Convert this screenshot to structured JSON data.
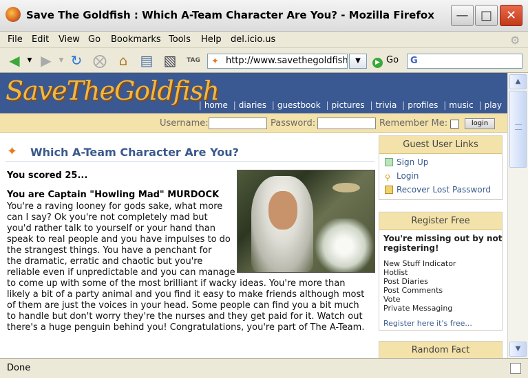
{
  "window": {
    "title": "Save The Goldfish : Which A-Team Character Are You? - Mozilla Firefox"
  },
  "menu": [
    "File",
    "Edit",
    "View",
    "Go",
    "Bookmarks",
    "Tools",
    "Help",
    "del.icio.us"
  ],
  "toolbar": {
    "url": "http://www.savethegoldfish.c",
    "go_label": "Go",
    "search_value": "G",
    "icons": [
      "back-icon",
      "forward-icon",
      "reload-icon",
      "stop-icon",
      "home-icon",
      "print-icon",
      "screenshot-icon",
      "tag-icon"
    ]
  },
  "site": {
    "logo": "SaveTheGoldfish",
    "nav": [
      "home",
      "diaries",
      "guestbook",
      "pictures",
      "trivia",
      "profiles",
      "music",
      "play"
    ],
    "login": {
      "username_label": "Username:",
      "password_label": "Password:",
      "remember_label": "Remember Me:",
      "login_button": "login"
    }
  },
  "article": {
    "heading": "Which A-Team Character Are You?",
    "scored": "You scored 25...",
    "result": "You are Captain \"Howling Mad\" MURDOCK",
    "lines": [
      "You're a raving looney for gods sake, what more",
      "can I say? Ok you're not completely mad but",
      "you'd rather talk to yourself or your hand than",
      "speak to real people and you have impulses to do",
      "the strangest things. You have a penchant for",
      "the dramatic, erratic and chaotic but you're",
      "reliable even if unpredictable and you can manage",
      "to come up with some of the most brilliant if wacky ideas. You're more than",
      "likely a bit of a party animal and you find it easy to make friends although most",
      "of them are just the voices in your head. Some people can find you a bit much",
      "to handle but don't worry they're the nurses and they get paid for it. Watch out",
      "there's a huge penguin behind you! Congratulations, you're part of The A-Team."
    ]
  },
  "sidebar": {
    "guest": {
      "title": "Guest User Links",
      "items": [
        "Sign Up",
        "Login",
        "Recover Lost Password"
      ]
    },
    "register": {
      "title": "Register Free",
      "missing": [
        "You're missing out by not",
        "registering!"
      ],
      "features": [
        "New Stuff Indicator",
        "Hotlist",
        "Post Diaries",
        "Post Comments",
        "Vote",
        "Private Messaging"
      ],
      "link": "Register here it's free..."
    },
    "random": {
      "title": "Random Fact"
    }
  },
  "status": {
    "text": "Done"
  },
  "colors": {
    "header": "#3a5892",
    "accent": "#f3e2a9",
    "link": "#3a5a8c"
  }
}
